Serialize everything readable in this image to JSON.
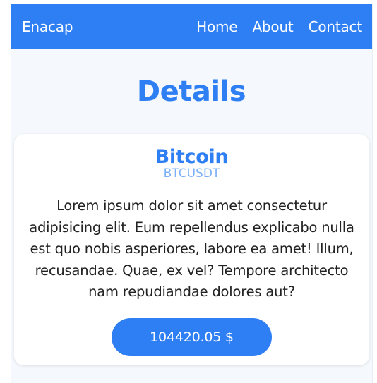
{
  "navbar": {
    "brand": "Enacap",
    "links": [
      "Home",
      "About",
      "Contact"
    ]
  },
  "page": {
    "title": "Details"
  },
  "coin": {
    "name": "Bitcoin",
    "symbol": "BTCUSDT",
    "description": "Lorem ipsum dolor sit amet consectetur adipisicing elit. Eum repellendus explicabo nulla est quo nobis asperiores, labore ea amet! Illum, recusandae. Quae, ex vel? Tempore architecto nam repudiandae dolores aut?",
    "price": "104420.05 $"
  },
  "colors": {
    "accent": "#2f7ff4",
    "symbol": "#7ab0f7",
    "background": "#f5f8fc",
    "card": "#ffffff",
    "text": "#222222"
  }
}
